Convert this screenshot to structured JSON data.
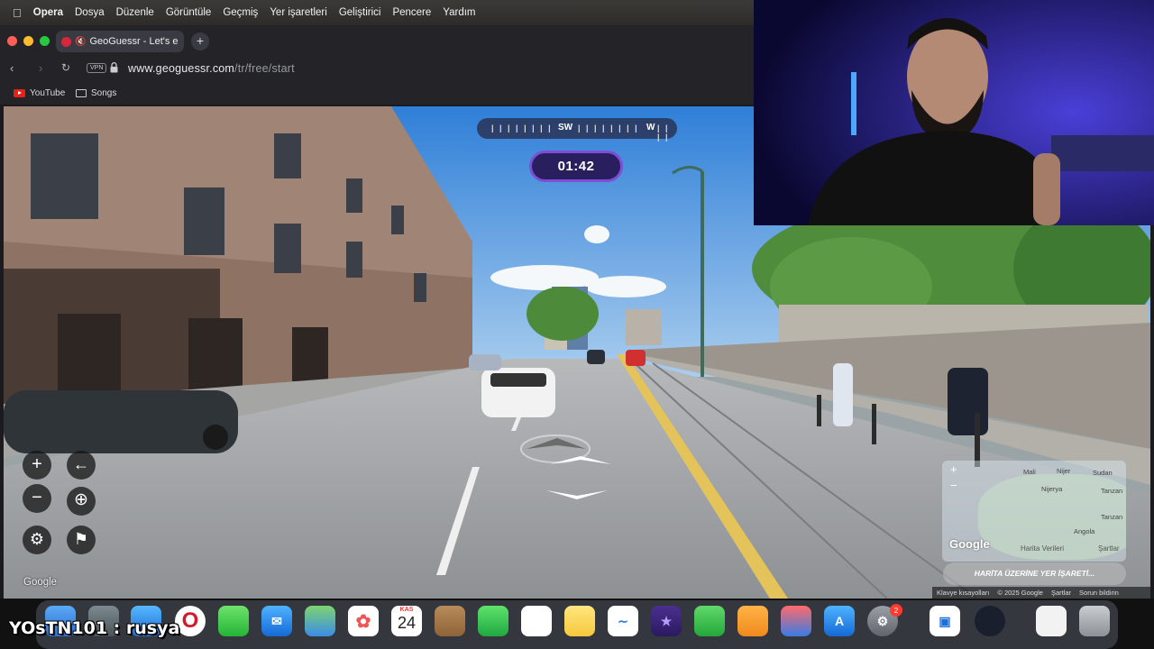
{
  "menubar": {
    "apple_icon": "apple-logo",
    "app_name": "Opera",
    "items": [
      "Dosya",
      "Düzenle",
      "Görüntüle",
      "Geçmiş",
      "Yer işaretleri",
      "Geliştirici",
      "Pencere",
      "Yardım"
    ]
  },
  "browser": {
    "tab_title": "GeoGuessr - Let's e",
    "new_tab_label": "+",
    "vpn_label": "VPN",
    "url_host": "www.geoguessr.com",
    "url_path": "/tr/free/start",
    "bookmarks": [
      {
        "label": "YouTube",
        "icon": "youtube-icon"
      },
      {
        "label": "Songs",
        "icon": "folder-icon"
      }
    ]
  },
  "game": {
    "compass_left_ticks": "| | | | | | | |",
    "compass_mid_ticks": "| | | | | | | |",
    "compass_right_ticks": "| | | |",
    "compass_labels": [
      "SW",
      "W"
    ],
    "timer": "01:42",
    "google_logo_left": "Google",
    "minimap": {
      "labels": [
        "Mali",
        "Nijer",
        "Sudan",
        "Nijerya",
        "Tanzan",
        "Angola",
        "Tanzan"
      ],
      "google_logo": "Google",
      "data_label": "Harita Verileri",
      "terms_label": "Şartlar",
      "zoom_in": "+",
      "zoom_out": "−"
    },
    "guess_button": "HARİTA ÜZERİNE YER İŞARETİ...",
    "footer": [
      "Klavye kısayolları",
      "© 2025 Google",
      "Şartlar",
      "Sorun bildirin"
    ],
    "controls": {
      "zoom_in": "+",
      "zoom_out": "−",
      "undo": "←",
      "checkpoint": "⊕",
      "settings": "⚙",
      "flag": "⚑"
    }
  },
  "dock": {
    "calendar_month": "KAS",
    "calendar_day": "24",
    "settings_badge": "2"
  },
  "stream_overlay": "YOsTN101 : rusya"
}
